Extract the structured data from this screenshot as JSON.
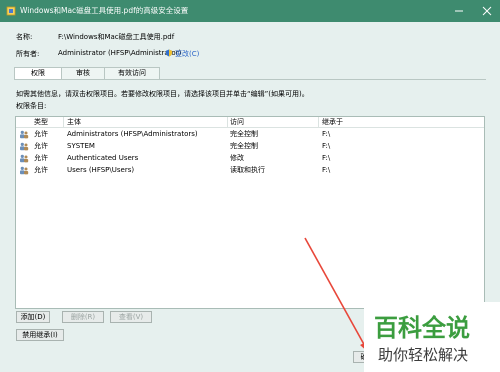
{
  "window": {
    "title": "Windows和Mac磁盘工具使用.pdf的高级安全设置",
    "minimize_icon": "minimize-icon",
    "close_icon": "close-icon"
  },
  "info": {
    "name_label": "名称:",
    "name_value": "F:\\Windows和Mac磁盘工具使用.pdf",
    "owner_label": "所有者:",
    "owner_value": "Administrator (HFSP\\Administrator)",
    "change_link": "更改(C)"
  },
  "tabs": [
    {
      "label": "权限",
      "active": true
    },
    {
      "label": "审核",
      "active": false
    },
    {
      "label": "有效访问",
      "active": false
    }
  ],
  "hint": "如需其他信息，请双击权限项目。若要修改权限项目，请选择该项目并单击“编辑”(如果可用)。",
  "entries_label": "权限条目:",
  "table": {
    "columns": [
      "类型",
      "主体",
      "访问",
      "继承于"
    ],
    "rows": [
      {
        "type": "允许",
        "principal": "Administrators (HFSP\\Administrators)",
        "access": "完全控制",
        "inherited": "F:\\"
      },
      {
        "type": "允许",
        "principal": "SYSTEM",
        "access": "完全控制",
        "inherited": "F:\\"
      },
      {
        "type": "允许",
        "principal": "Authenticated Users",
        "access": "修改",
        "inherited": "F:\\"
      },
      {
        "type": "允许",
        "principal": "Users (HFSP\\Users)",
        "access": "读取和执行",
        "inherited": "F:\\"
      }
    ]
  },
  "buttons": {
    "add": "添加(D)",
    "remove": "删除(R)",
    "view": "查看(V)",
    "disable_inheritance": "禁用继承(I)",
    "ok_partial": "确"
  },
  "watermark": {
    "title": "百科全说",
    "subtitle": "助你轻松解决"
  },
  "colors": {
    "titlebar": "#3e8b6f",
    "window_bg": "#e6f0ee",
    "link": "#2a64c8",
    "arrow": "#e8473a"
  }
}
